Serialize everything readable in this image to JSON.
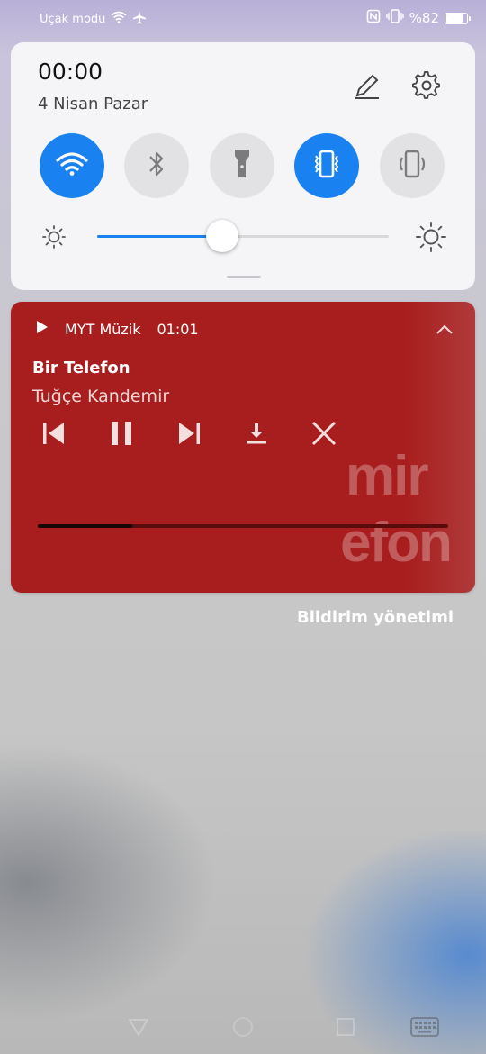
{
  "status_bar": {
    "mode_label": "Uçak modu",
    "battery_text": "%82",
    "battery_level": 0.82,
    "icons": [
      "wifi-icon",
      "airplane-icon",
      "nfc-icon",
      "vibrate-icon",
      "battery-icon"
    ]
  },
  "quick_settings": {
    "time": "00:00",
    "date": "4 Nisan Pazar",
    "toggles": [
      {
        "name": "wifi",
        "icon": "wifi-icon",
        "on": true
      },
      {
        "name": "bluetooth",
        "icon": "bluetooth-icon",
        "on": false
      },
      {
        "name": "flashlight",
        "icon": "flashlight-icon",
        "on": false
      },
      {
        "name": "vibrate",
        "icon": "vibrate-icon",
        "on": true
      },
      {
        "name": "auto-rotate",
        "icon": "rotate-icon",
        "on": false
      }
    ],
    "brightness_level": 0.43,
    "accent_color": "#1a82f0"
  },
  "media": {
    "app_name": "MYT Müzik",
    "elapsed": "01:01",
    "song_title": "Bir Telefon",
    "artist": "Tuğçe Kandemir",
    "progress": 0.23,
    "background_color": "#a81e1e",
    "artwork_text_1": "mir",
    "artwork_text_2": "efon",
    "controls": [
      "previous-icon",
      "pause-icon",
      "next-icon",
      "download-icon",
      "close-icon"
    ]
  },
  "notification_management": "Bildirim yönetimi"
}
